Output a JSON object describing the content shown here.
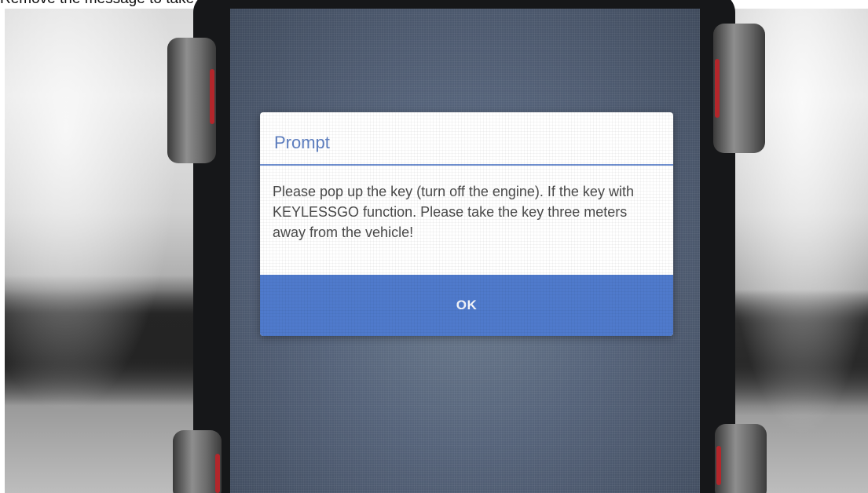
{
  "caption": {
    "text": "Remove the message to take it on the key"
  },
  "dialog": {
    "title": "Prompt",
    "message": "Please pop up the key (turn off the engine). If the key with KEYLESSGO function. Please take the key three meters away from the vehicle!",
    "ok_label": "OK"
  },
  "colors": {
    "dialog_title": "#5e7fc1",
    "ok_button": "#4f7acc",
    "divider": "#6f8fcf",
    "holder_accent": "#b3262b"
  }
}
